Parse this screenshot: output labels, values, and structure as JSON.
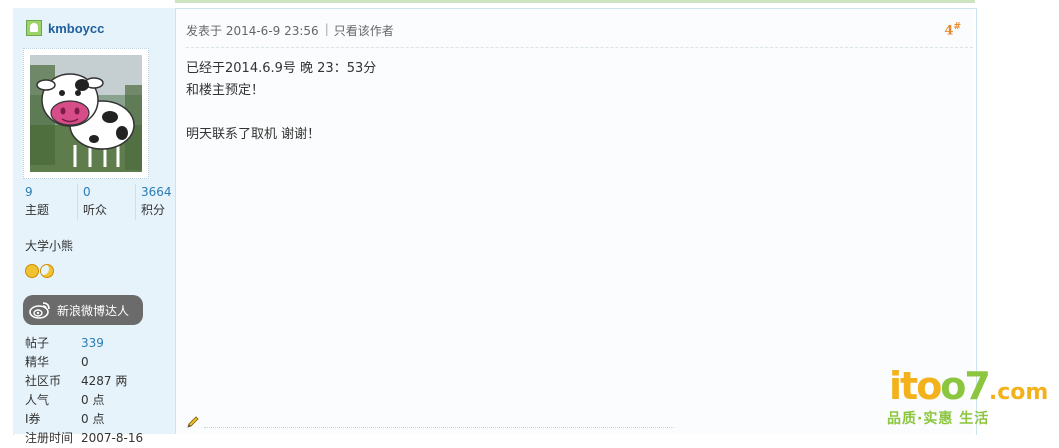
{
  "user": {
    "name": "kmboycc",
    "stats": [
      {
        "value": "9",
        "label": "主题"
      },
      {
        "value": "0",
        "label": "听众"
      },
      {
        "value": "3664",
        "label": "积分"
      }
    ],
    "title": "大学小熊",
    "badge_label": "新浪微博达人",
    "info": [
      {
        "label": "帖子",
        "value": "339"
      },
      {
        "label": "精华",
        "value": "0"
      },
      {
        "label": "社区币",
        "value": "4287 两"
      },
      {
        "label": "人气",
        "value": "0 点"
      },
      {
        "label": "I券",
        "value": "0 点"
      },
      {
        "label": "注册时间",
        "value": "2007-8-16"
      }
    ]
  },
  "post": {
    "posted_at": "发表于 2014-6-9 23:56",
    "only_author": "只看该作者",
    "separator": "|",
    "floor_num": "4",
    "floor_mark": "#",
    "lines": [
      "已经于2014.6.9号 晚 23：53分",
      "和楼主预定！",
      "",
      "明天联系了取机 谢谢！"
    ]
  },
  "watermark": {
    "logo_a": "ito",
    "logo_b": "o7",
    "logo_c": ".com",
    "tagline": "品质·实惠 生活"
  }
}
